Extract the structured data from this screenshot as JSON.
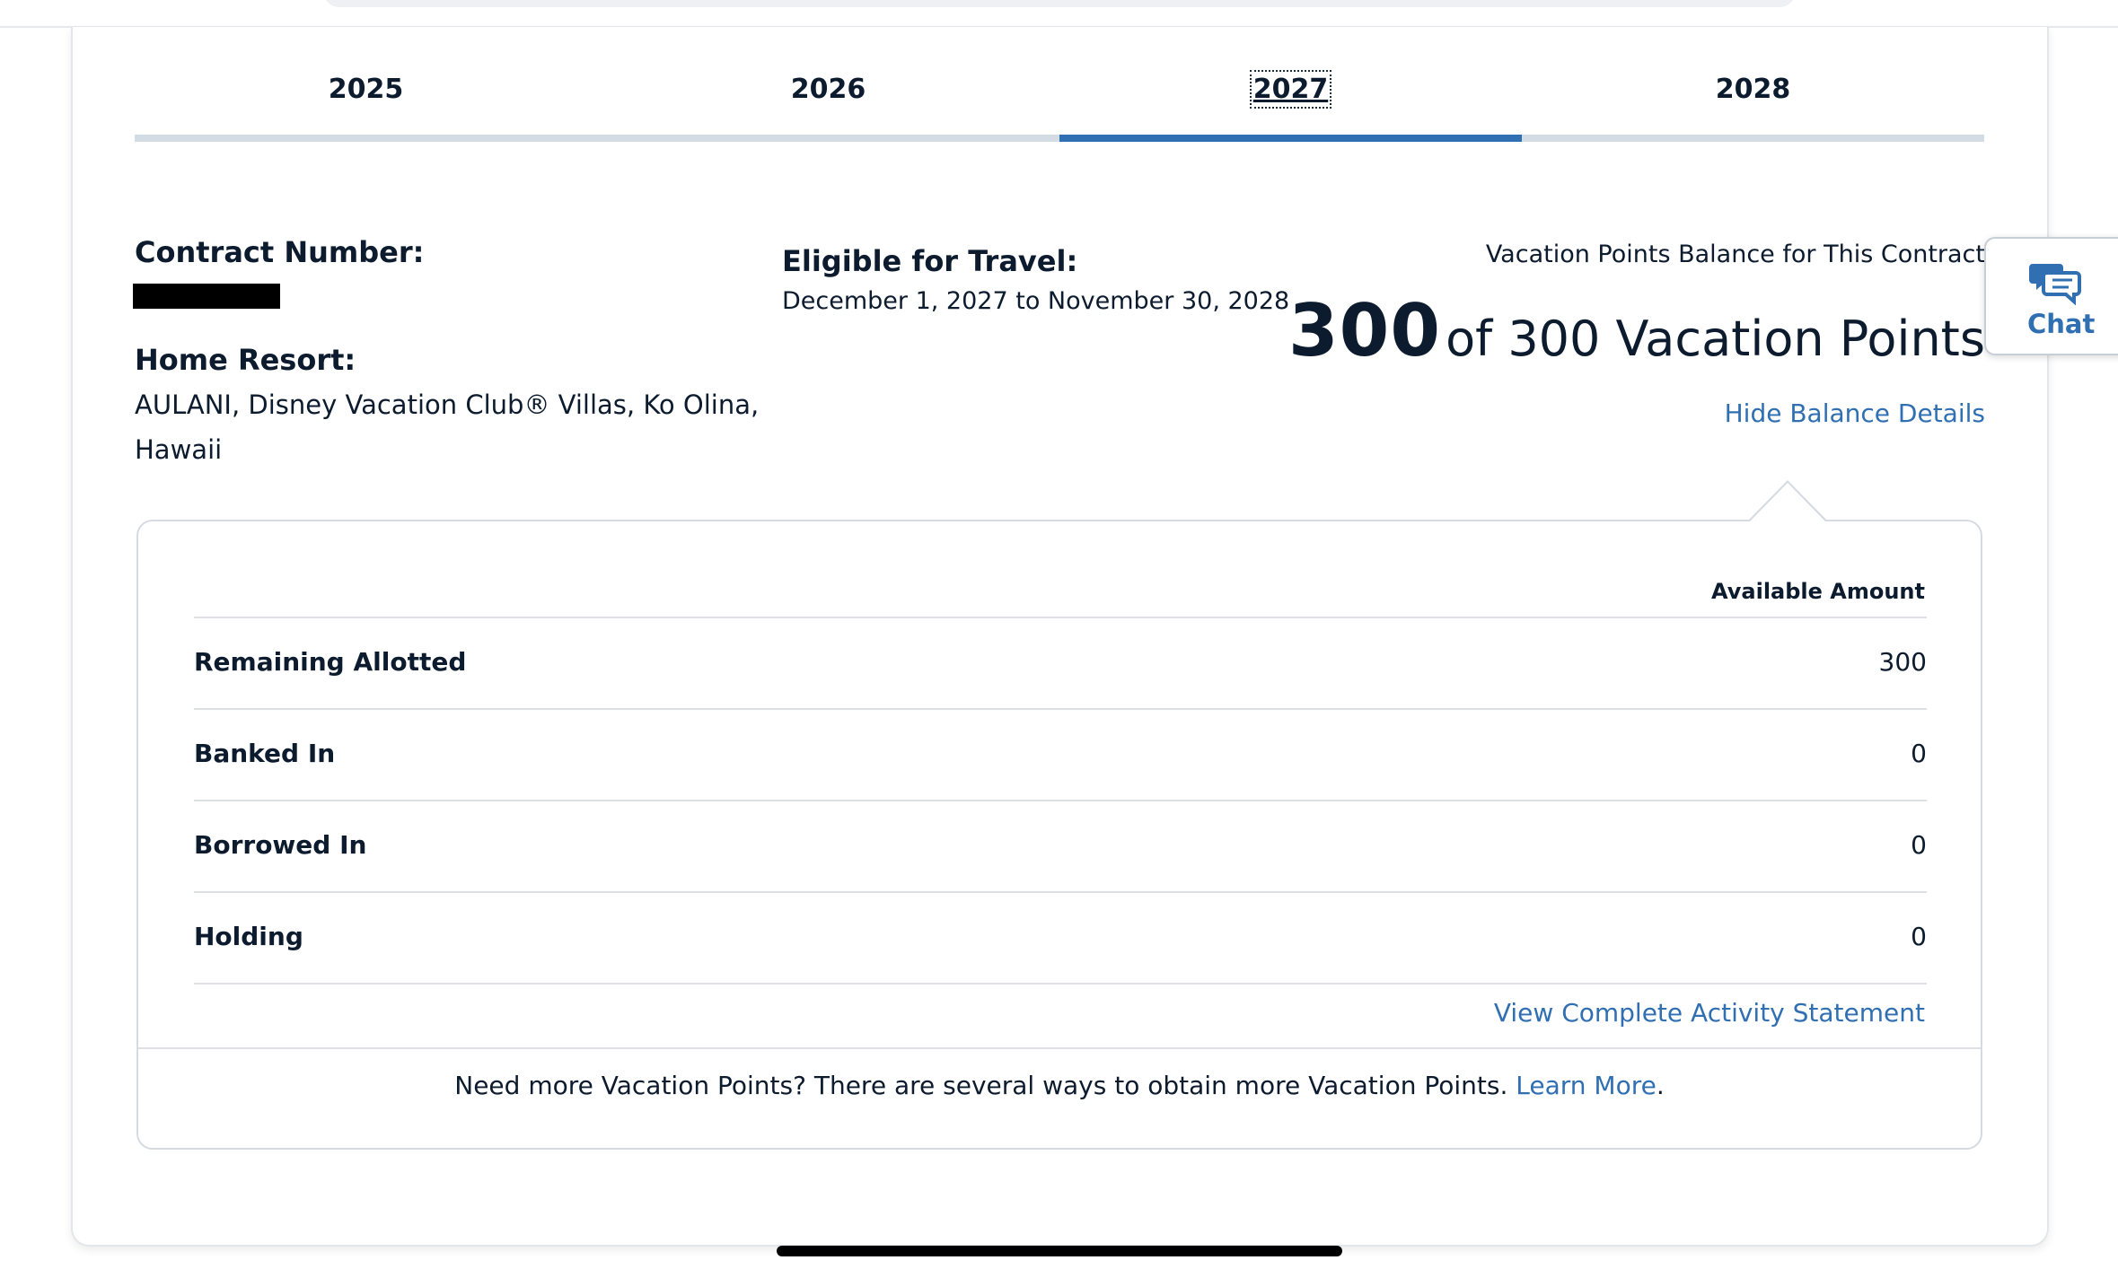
{
  "tabs": [
    {
      "label": "2025"
    },
    {
      "label": "2026"
    },
    {
      "label": "2027",
      "active": true
    },
    {
      "label": "2028"
    }
  ],
  "contract": {
    "number_label": "Contract Number:",
    "home_resort_label": "Home Resort:",
    "home_resort_line1": "AULANI, Disney Vacation Club® Villas, Ko Olina,",
    "home_resort_line2": "Hawaii",
    "eligible_label": "Eligible for Travel:",
    "eligible_dates": "December 1, 2027 to November 30, 2028"
  },
  "balance": {
    "caption": "Vacation Points Balance for This Contract",
    "current": "300",
    "rest": "of 300 Vacation Points",
    "hide_link": "Hide Balance Details"
  },
  "chat": {
    "label": "Chat",
    "icon": "chat-bubbles-icon"
  },
  "details": {
    "column_header": "Available Amount",
    "rows": [
      {
        "label": "Remaining Allotted",
        "value": "300"
      },
      {
        "label": "Banked In",
        "value": "0"
      },
      {
        "label": "Borrowed In",
        "value": "0"
      },
      {
        "label": "Holding",
        "value": "0"
      }
    ],
    "activity_link": "View Complete Activity Statement",
    "footer_text": "Need more Vacation Points? There are several ways to obtain more Vacation Points. ",
    "footer_link": "Learn More",
    "footer_period": "."
  },
  "colors": {
    "accent": "#2f6fb2",
    "text": "#0c1b2e",
    "tab_inactive": "#d3dbe4"
  }
}
